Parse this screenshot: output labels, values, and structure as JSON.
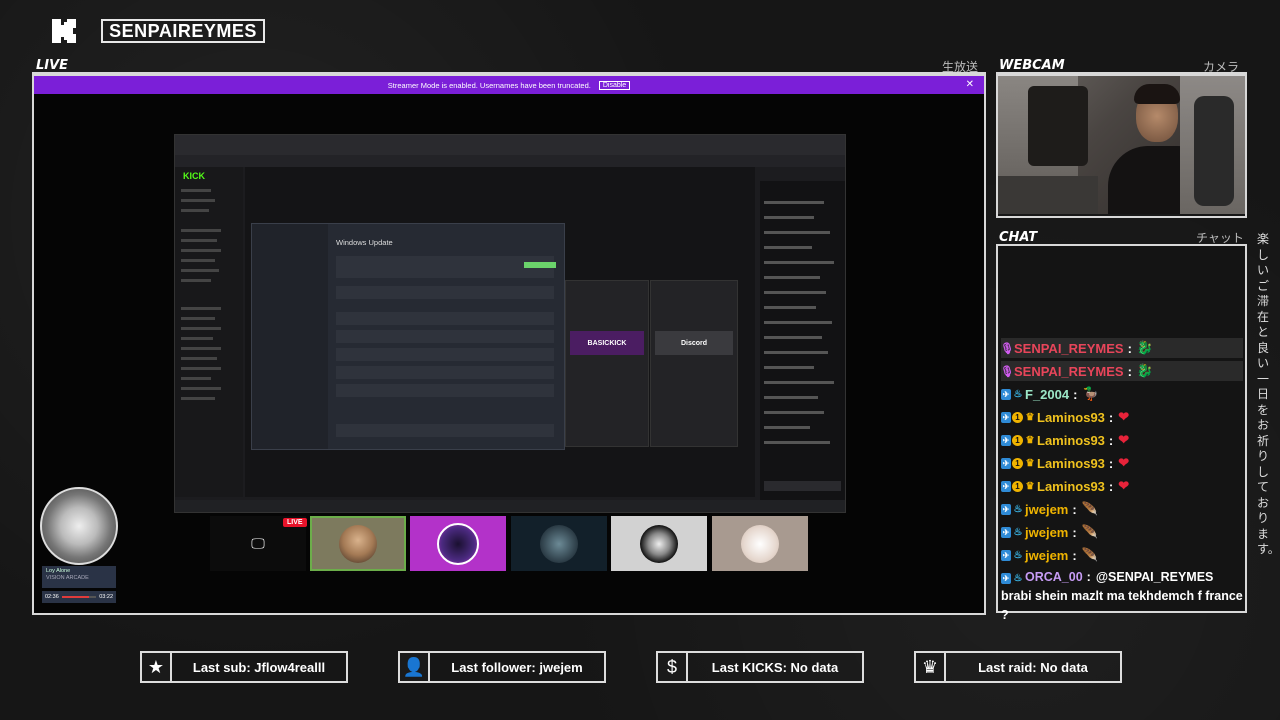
{
  "header": {
    "channel_name": "SENPAIREYMES"
  },
  "panels": {
    "live_label": "LIVE",
    "live_jp": "生放送",
    "webcam_label": "WEBCAM",
    "webcam_jp": "カメラ",
    "chat_label": "CHAT",
    "chat_jp": "チャット"
  },
  "streamer_bar": {
    "message": "Streamer Mode is enabled. Usernames have been truncated.",
    "disable_label": "Disable",
    "close": "✕"
  },
  "screen": {
    "kick_logo": "KICK",
    "windows_update_title": "Windows Update",
    "banner1": "BASICKICK",
    "banner2": "Discord",
    "live_badge": "LIVE"
  },
  "music": {
    "title": "Loy Alone",
    "artist": "VISION ARCADE",
    "elapsed": "02:36",
    "total": "03:22",
    "progress": 0.78
  },
  "chat": {
    "messages": [
      {
        "user": "SENPAI_REYMES",
        "color": "#e8455a",
        "badges": [
          "mic"
        ],
        "text": "",
        "emote": "🐉",
        "highlight": true
      },
      {
        "user": "SENPAI_REYMES",
        "color": "#e8455a",
        "badges": [
          "mic"
        ],
        "text": "",
        "emote": "🐉",
        "highlight": true
      },
      {
        "user": "F_2004",
        "color": "#9ce7c7",
        "badges": [
          "blue",
          "teal"
        ],
        "text": "",
        "emote": "🦆",
        "highlight": false
      },
      {
        "user": "Laminos93",
        "color": "#f0c21e",
        "badges": [
          "blue",
          "yellow",
          "gold"
        ],
        "text": "",
        "emote": "❤",
        "highlight": false
      },
      {
        "user": "Laminos93",
        "color": "#f0c21e",
        "badges": [
          "blue",
          "yellow",
          "gold"
        ],
        "text": "",
        "emote": "❤",
        "highlight": false
      },
      {
        "user": "Laminos93",
        "color": "#f0c21e",
        "badges": [
          "blue",
          "yellow",
          "gold"
        ],
        "text": "",
        "emote": "❤",
        "highlight": false
      },
      {
        "user": "Laminos93",
        "color": "#f0c21e",
        "badges": [
          "blue",
          "yellow",
          "gold"
        ],
        "text": "",
        "emote": "❤",
        "highlight": false
      },
      {
        "user": "jwejem",
        "color": "#f0b400",
        "badges": [
          "blue",
          "teal"
        ],
        "text": "",
        "emote": "🪶",
        "highlight": false
      },
      {
        "user": "jwejem",
        "color": "#f0b400",
        "badges": [
          "blue",
          "teal"
        ],
        "text": "",
        "emote": "🪶",
        "highlight": false
      },
      {
        "user": "jwejem",
        "color": "#f0b400",
        "badges": [
          "blue",
          "teal"
        ],
        "text": "",
        "emote": "🪶",
        "highlight": false
      }
    ],
    "last": {
      "user": "ORCA_00",
      "color": "#c79cf5",
      "text": "@SENPAI_REYMES brabi shein mazlt ma tekhdemch f france ?"
    }
  },
  "vertical_jp": "楽しいご滞在と良い一日をお祈りしております。",
  "stats": {
    "last_sub": "Last sub: Jflow4realll",
    "last_follower": "Last follower: jwejem",
    "last_kicks": "Last KICKS: No data",
    "last_raid": "Last raid: No data"
  },
  "colors": {
    "accent_purple": "#7b1fd8",
    "kick_green": "#53fc18",
    "live_red": "#e8132a"
  }
}
